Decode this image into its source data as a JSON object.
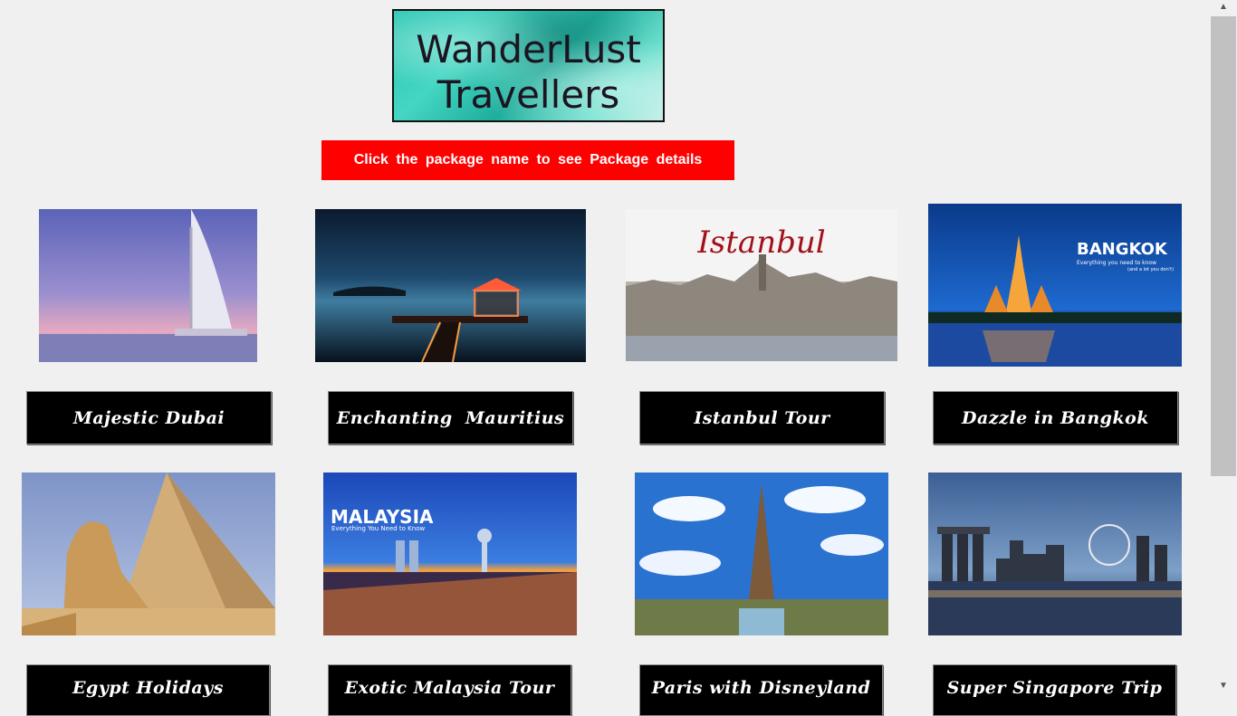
{
  "logo": {
    "line1": "WanderLust",
    "line2": "Travellers"
  },
  "banner": {
    "text": "Click  the  package  name  to  see  Package  details"
  },
  "packages": [
    {
      "name": "Majestic Dubai",
      "image_text": ""
    },
    {
      "name": "Enchanting  Mauritius",
      "image_text": ""
    },
    {
      "name": "Istanbul Tour",
      "image_text": "Istanbul"
    },
    {
      "name": "Dazzle in Bangkok",
      "image_text": "BANGKOK",
      "image_subtext": "Everything you need to know",
      "image_subtext2": "(and a lot you don't)"
    },
    {
      "name": "Egypt Holidays",
      "image_text": ""
    },
    {
      "name": "Exotic Malaysia Tour",
      "image_text": "MALAYSIA",
      "image_subtext": "Everything You Need to Know"
    },
    {
      "name": "Paris with Disneyland",
      "image_text": ""
    },
    {
      "name": "Super Singapore Trip",
      "image_text": ""
    }
  ],
  "scrollbar": {
    "up_icon": "▲",
    "down_icon": "▼"
  }
}
